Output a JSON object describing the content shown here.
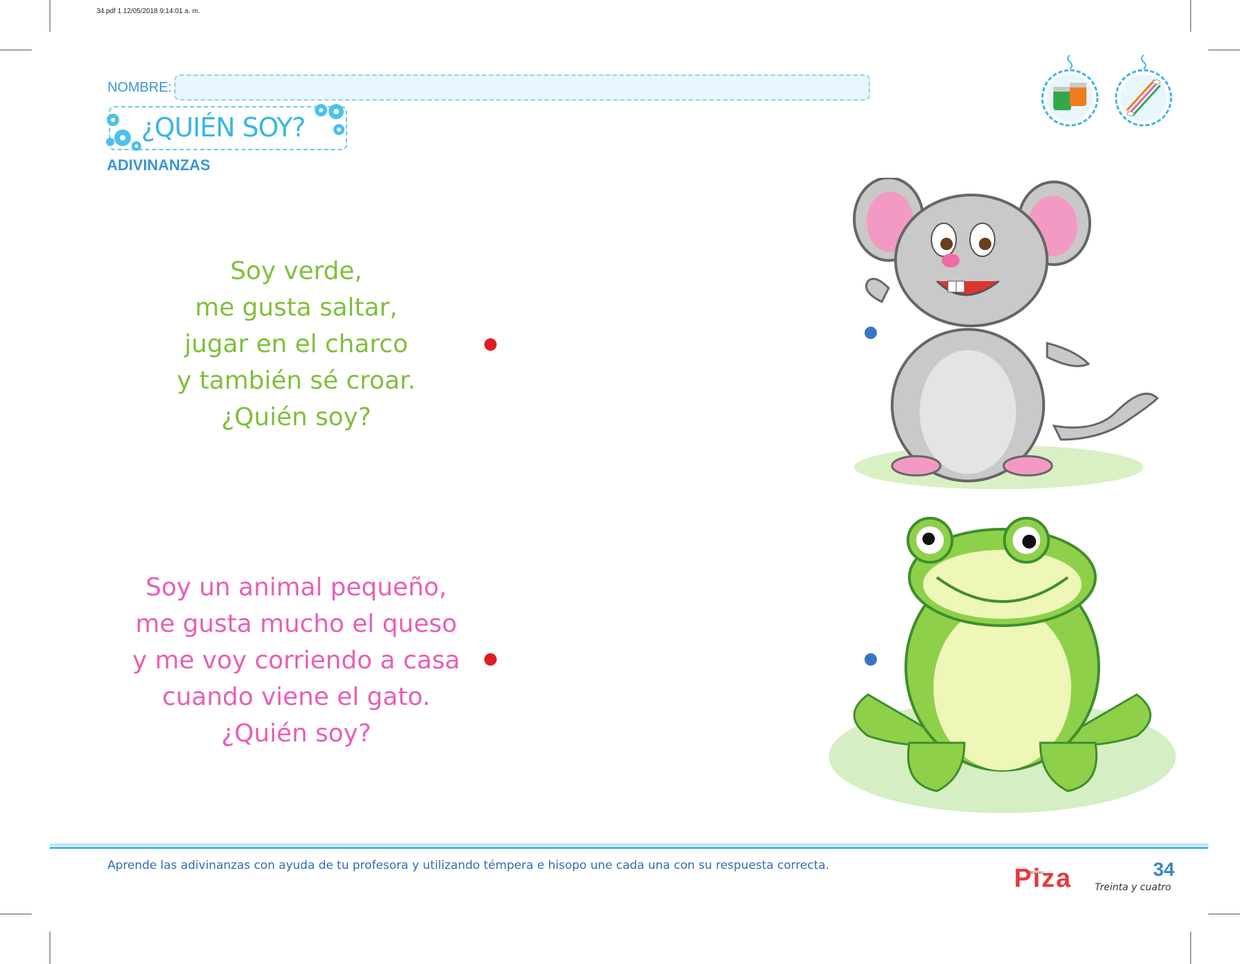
{
  "print_info": "34.pdf   1   12/05/2018   9:14:01 a. m.",
  "header": {
    "name_label": "NOMBRE:",
    "title": "¿QUIÉN SOY?",
    "subtitle": "ADIVINANZAS"
  },
  "materials_icons": [
    "paint-jars-icon",
    "cotton-swabs-icon"
  ],
  "riddles": [
    {
      "color": "#7fbf3c",
      "lines": [
        "Soy verde,",
        "me gusta saltar,",
        "jugar en el charco",
        "y también sé croar.",
        "¿Quién soy?"
      ],
      "dot_color": "#e31c24"
    },
    {
      "color": "#e85fb6",
      "lines": [
        "Soy un animal pequeño,",
        "me gusta mucho el queso",
        "y me voy corriendo a casa",
        "cuando viene el gato.",
        "¿Quién soy?"
      ],
      "dot_color": "#e31c24"
    }
  ],
  "answers": [
    {
      "image": "mouse-illustration",
      "dot_color": "#3a75c4"
    },
    {
      "image": "frog-illustration",
      "dot_color": "#3a75c4"
    }
  ],
  "footer": {
    "instruction": "Aprende las adivinanzas con ayuda de tu profesora y utilizando témpera e hisopo une cada una con su respuesta correcta.",
    "brand_small": "ediciones",
    "brand": "Piza",
    "page_number": "34",
    "page_words": "Treinta y cuatro"
  },
  "colors": {
    "accent_blue": "#39b6e6",
    "frog_green": "#7fbf3c",
    "mouse_pink": "#e85fb6",
    "dot_red": "#e31c24",
    "dot_blue": "#3a75c4"
  }
}
